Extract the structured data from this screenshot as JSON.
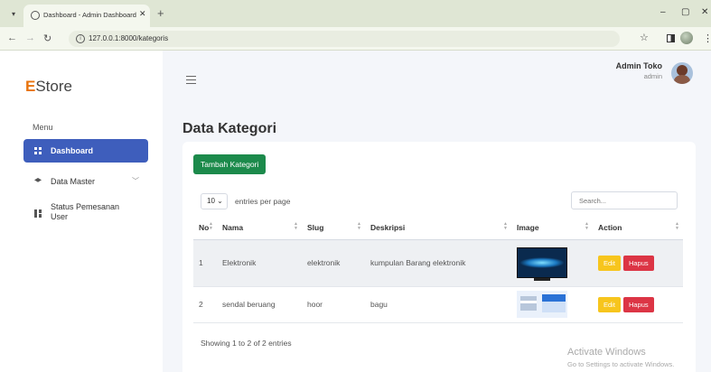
{
  "browser": {
    "tab_title": "Dashboard - Admin Dashboard",
    "tab_close": "✕",
    "new_tab": "+",
    "url": "127.0.0.1:8000/kategoris",
    "minimize": "–",
    "maximize": "▢",
    "close": "✕"
  },
  "sidebar": {
    "brand_first": "E",
    "brand_rest": "Store",
    "menu_label": "Menu",
    "items": [
      {
        "label": "Dashboard",
        "active": true,
        "icon": "grid-icon"
      },
      {
        "label": "Data Master",
        "active": false,
        "icon": "layers-icon",
        "chevron": "﹀"
      },
      {
        "label": "Status Pemesanan User",
        "active": false,
        "icon": "blocks-icon"
      }
    ]
  },
  "header": {
    "user_name": "Admin Toko",
    "user_role": "admin"
  },
  "page": {
    "title": "Data Kategori",
    "add_button": "Tambah Kategori",
    "per_page_value": "10",
    "per_page_label": "entries per page",
    "search_placeholder": "Search...",
    "columns": [
      "No",
      "Nama",
      "Slug",
      "Deskripsi",
      "Image",
      "Action"
    ],
    "rows": [
      {
        "no": "1",
        "nama": "Elektronik",
        "slug": "elektronik",
        "deskripsi": "kumpulan Barang elektronik",
        "image": "tv-image"
      },
      {
        "no": "2",
        "nama": "sendal beruang",
        "slug": "hoor",
        "deskripsi": "bagu",
        "image": "ui-screenshot-image"
      }
    ],
    "edit_label": "Edit",
    "delete_label": "Hapus",
    "showing": "Showing 1 to 2 of 2 entries"
  },
  "watermark": {
    "title": "Activate Windows",
    "subtitle": "Go to Settings to activate Windows."
  },
  "colors": {
    "accent": "#3e5ebc",
    "add_button": "#1c8a4b",
    "edit_button": "#f7c51d",
    "delete_button": "#dc3545",
    "brand_letter": "#e8730c"
  }
}
